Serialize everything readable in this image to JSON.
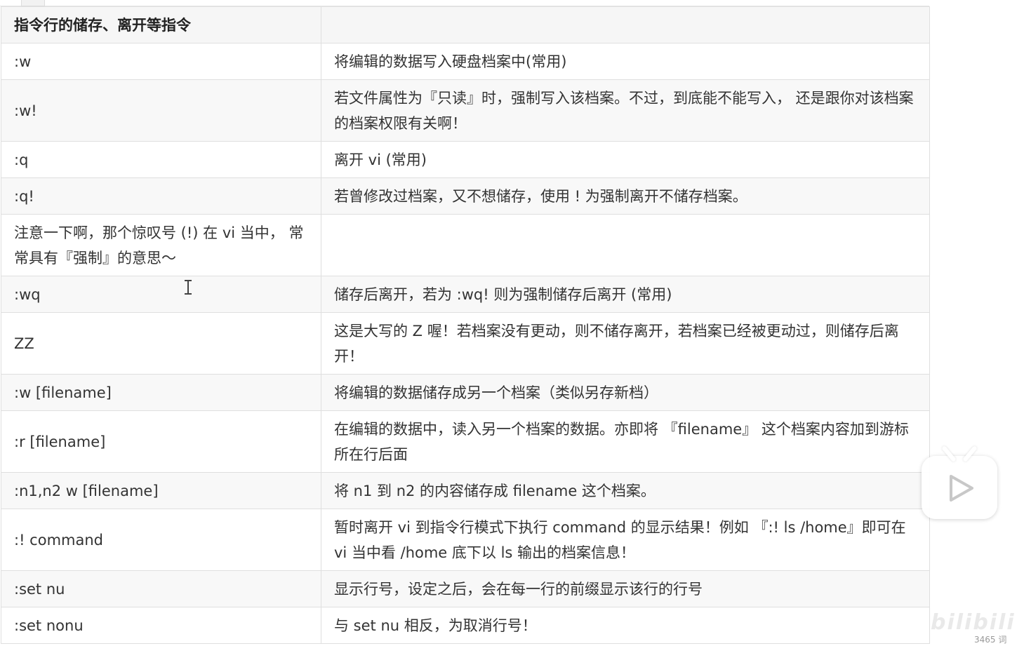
{
  "table": {
    "header": [
      "指令行的储存、离开等指令",
      ""
    ],
    "rows": [
      {
        "cmd": ":w",
        "desc": "将编辑的数据写入硬盘档案中(常用)"
      },
      {
        "cmd": ":w!",
        "desc": "若文件属性为『只读』时，强制写入该档案。不过，到底能不能写入， 还是跟你对该档案的档案权限有关啊！"
      },
      {
        "cmd": ":q",
        "desc": "离开 vi (常用)"
      },
      {
        "cmd": ":q!",
        "desc": "若曾修改过档案，又不想储存，使用 ! 为强制离开不储存档案。"
      },
      {
        "cmd": "注意一下啊，那个惊叹号 (!) 在 vi 当中， 常常具有『强制』的意思～",
        "desc": ""
      },
      {
        "cmd": ":wq",
        "desc": "储存后离开，若为 :wq! 则为强制储存后离开 (常用)"
      },
      {
        "cmd": "ZZ",
        "desc": "这是大写的 Z 喔！若档案没有更动，则不储存离开，若档案已经被更动过，则储存后离开！"
      },
      {
        "cmd": ":w [filename]",
        "desc": "将编辑的数据储存成另一个档案（类似另存新档）"
      },
      {
        "cmd": ":r [filename]",
        "desc": "在编辑的数据中，读入另一个档案的数据。亦即将 『filename』 这个档案内容加到游标所在行后面"
      },
      {
        "cmd": ":n1,n2 w [filename]",
        "desc": "将 n1 到 n2 的内容储存成 filename 这个档案。"
      },
      {
        "cmd": ":! command",
        "desc": "暂时离开 vi 到指令行模式下执行 command 的显示结果！例如 『:! ls /home』即可在 vi 当中看 /home 底下以 ls 输出的档案信息！"
      },
      {
        "cmd": ":set nu",
        "desc": "显示行号，设定之后，会在每一行的前缀显示该行的行号"
      },
      {
        "cmd": ":set nonu",
        "desc": "与 set nu 相反，为取消行号！"
      }
    ]
  },
  "overlay": {
    "play_icon": "play-icon",
    "watermark": "bilibili",
    "wordcount": "3465 词"
  }
}
